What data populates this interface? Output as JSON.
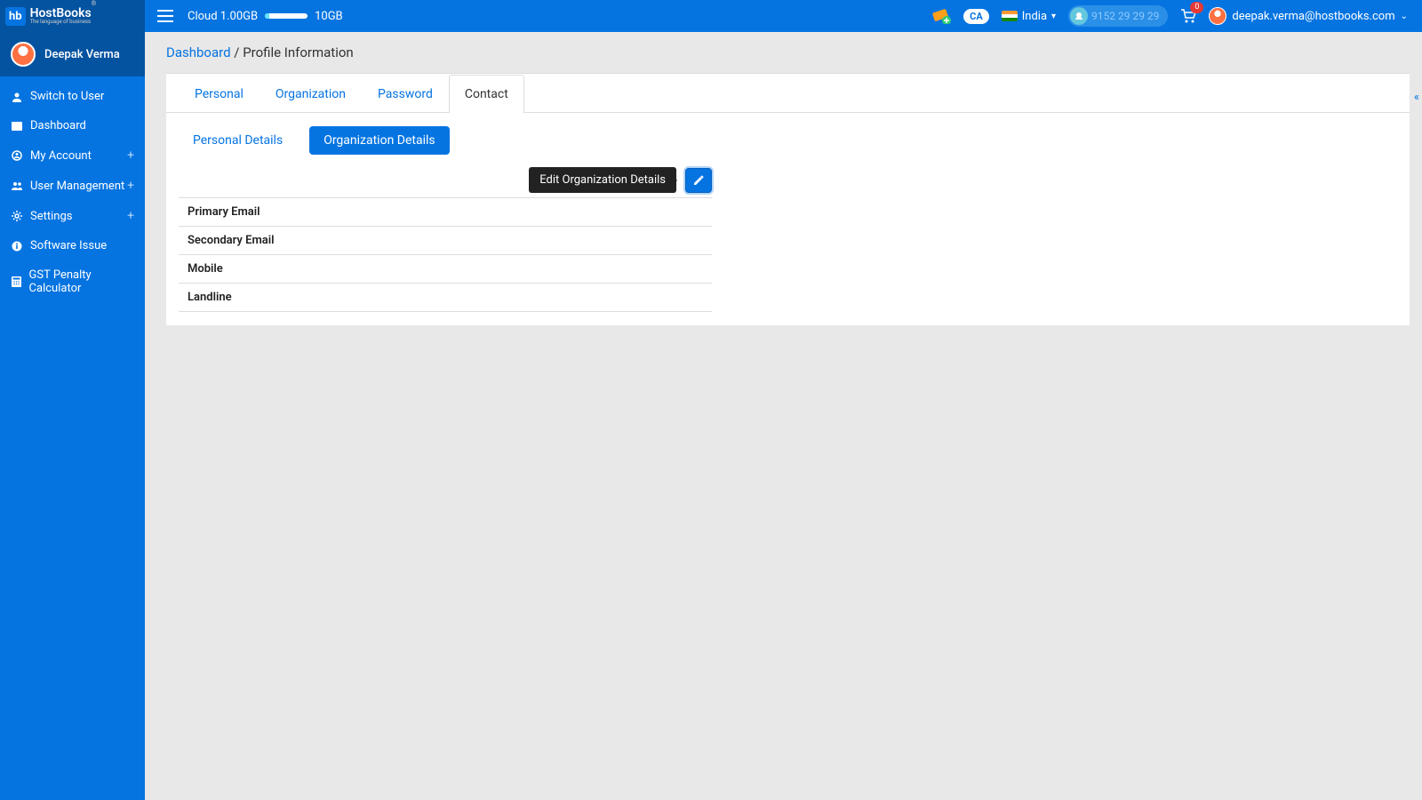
{
  "header": {
    "logo_prefix": "hb",
    "logo_text": "HostBooks",
    "logo_tagline": "The language of business",
    "cloud_label": "Cloud",
    "cloud_used": "1.00GB",
    "cloud_total": "10GB",
    "ca_badge": "CA",
    "country": "India",
    "support_phone": "9152 29 29 29",
    "cart_count": "0",
    "user_email": "deepak.verma@hostbooks.com"
  },
  "sidebar": {
    "user_name": "Deepak Verma",
    "items": [
      {
        "label": "Switch to User",
        "icon": "user",
        "expandable": false
      },
      {
        "label": "Dashboard",
        "icon": "dash",
        "expandable": false
      },
      {
        "label": "My Account",
        "icon": "account",
        "expandable": true
      },
      {
        "label": "User Management",
        "icon": "users",
        "expandable": true
      },
      {
        "label": "Settings",
        "icon": "gear",
        "expandable": true
      },
      {
        "label": "Software Issue",
        "icon": "info",
        "expandable": false
      },
      {
        "label": "GST Penalty Calculator",
        "icon": "calc",
        "expandable": false
      }
    ]
  },
  "breadcrumb": {
    "root": "Dashboard",
    "separator": " / ",
    "current": "Profile Information"
  },
  "tabs": {
    "main": [
      {
        "label": "Personal",
        "active": false
      },
      {
        "label": "Organization",
        "active": false
      },
      {
        "label": "Password",
        "active": false
      },
      {
        "label": "Contact",
        "active": true
      }
    ],
    "sub": [
      {
        "label": "Personal Details",
        "active": false
      },
      {
        "label": "Organization Details",
        "active": true
      }
    ]
  },
  "tooltip": "Edit Organization Details",
  "fields": [
    "Primary Email",
    "Secondary Email",
    "Mobile",
    "Landline"
  ]
}
